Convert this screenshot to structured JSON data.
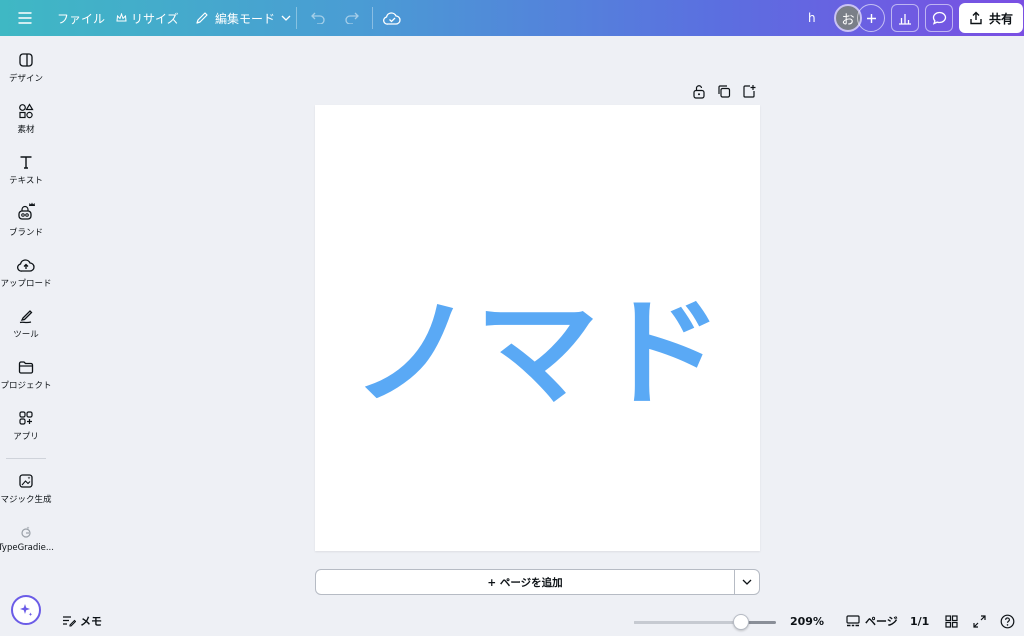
{
  "topbar": {
    "file_label": "ファイル",
    "resize_label": "リサイズ",
    "edit_mode_label": "編集モード",
    "user_initial": "h",
    "avatar_char": "お",
    "share_label": "共有"
  },
  "sidebar": {
    "items": [
      {
        "label": "デザイン",
        "icon": "design-icon"
      },
      {
        "label": "素材",
        "icon": "elements-icon"
      },
      {
        "label": "テキスト",
        "icon": "text-icon"
      },
      {
        "label": "ブランド",
        "icon": "brand-icon"
      },
      {
        "label": "アップロード",
        "icon": "upload-icon"
      },
      {
        "label": "ツール",
        "icon": "draw-icon"
      },
      {
        "label": "プロジェクト",
        "icon": "folder-icon"
      },
      {
        "label": "アプリ",
        "icon": "apps-icon"
      },
      {
        "label": "マジック生成",
        "icon": "magic-media-icon"
      },
      {
        "label": "TypeGradie...",
        "icon": "typegradient-icon"
      }
    ]
  },
  "canvas": {
    "text": "ノマド",
    "text_color": "#5aa9f5",
    "add_page_label": "+ ページを追加"
  },
  "bottombar": {
    "memo_label": "メモ",
    "zoom_value": "209%",
    "zoom_fraction": 0.75,
    "pages_label": "ページ",
    "page_count": "1/1"
  },
  "colors": {
    "accent": "#6b5ce7",
    "background": "#eef0f5"
  }
}
